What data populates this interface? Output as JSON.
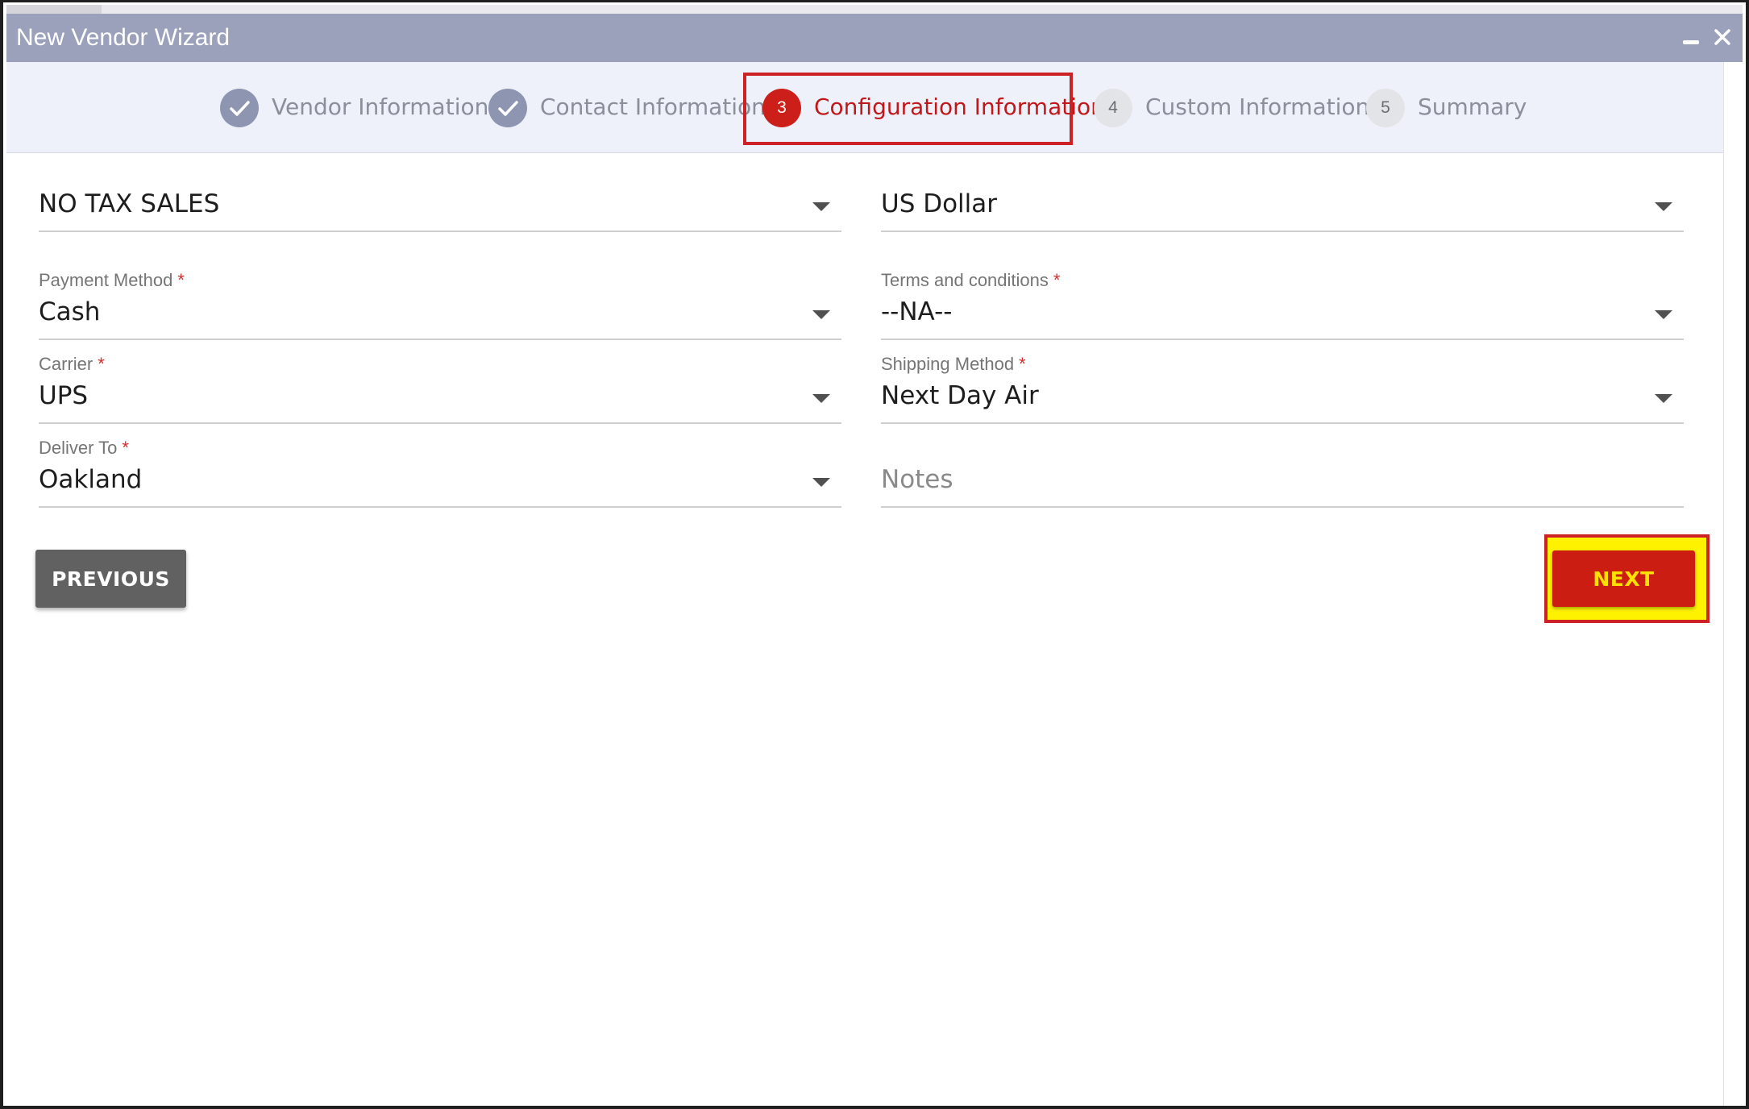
{
  "window": {
    "title": "New Vendor Wizard",
    "minimize_icon": "minimize-icon",
    "close_icon": "close-icon"
  },
  "steps": [
    {
      "number": "",
      "label": "Vendor Information",
      "state": "completed",
      "icon": "check-icon"
    },
    {
      "number": "",
      "label": "Contact Information",
      "state": "completed",
      "icon": "check-icon"
    },
    {
      "number": "3",
      "label": "Configuration Information",
      "state": "active"
    },
    {
      "number": "4",
      "label": "Custom Information",
      "state": "pending"
    },
    {
      "number": "5",
      "label": "Summary",
      "state": "pending"
    }
  ],
  "form": {
    "tax": {
      "value": "NO TAX SALES"
    },
    "currency": {
      "value": "US Dollar"
    },
    "payment_method": {
      "label": "Payment Method",
      "required_mark": "*",
      "value": "Cash"
    },
    "terms": {
      "label": "Terms and conditions",
      "required_mark": "*",
      "value": "--NA--"
    },
    "carrier": {
      "label": "Carrier",
      "required_mark": "*",
      "value": "UPS"
    },
    "shipping_method": {
      "label": "Shipping Method",
      "required_mark": "*",
      "value": "Next Day Air"
    },
    "deliver_to": {
      "label": "Deliver To",
      "required_mark": "*",
      "value": "Oakland"
    },
    "notes": {
      "placeholder": "Notes",
      "value": ""
    }
  },
  "buttons": {
    "previous": "PREVIOUS",
    "next": "NEXT"
  },
  "colors": {
    "titlebar": "#9ba1bb",
    "accent": "#cc1f1a",
    "highlight": "#fff200",
    "required": "#d32f2f"
  }
}
